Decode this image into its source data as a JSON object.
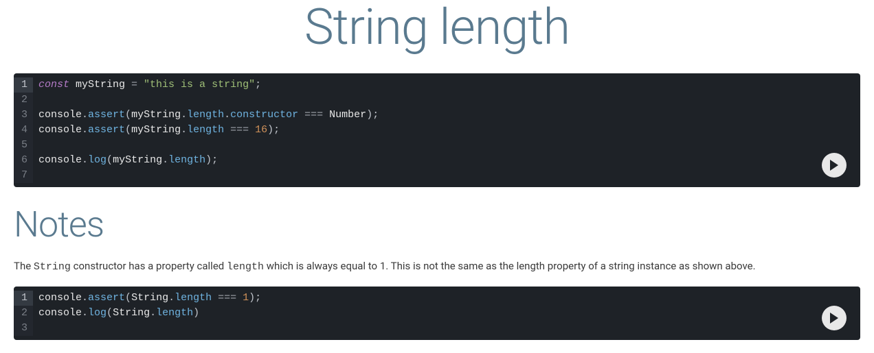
{
  "title": "String length",
  "notes_heading": "Notes",
  "note": {
    "p1": "The ",
    "code1": "String",
    "p2": " constructor has a property called ",
    "code2": "length",
    "p3": " which is always equal to 1. This is not the same as the length property of a string instance as shown above."
  },
  "code1": {
    "lines": [
      {
        "n": "1",
        "t": [
          [
            "k",
            "const"
          ],
          [
            "w",
            " myString"
          ],
          [
            "o",
            " = "
          ],
          [
            "s",
            "\"this is a string\""
          ],
          [
            "p",
            ";"
          ]
        ]
      },
      {
        "n": "2",
        "t": []
      },
      {
        "n": "3",
        "t": [
          [
            "w",
            "console"
          ],
          [
            "p",
            "."
          ],
          [
            "m",
            "assert"
          ],
          [
            "p",
            "("
          ],
          [
            "w",
            "myString"
          ],
          [
            "p",
            "."
          ],
          [
            "prop",
            "length"
          ],
          [
            "p",
            "."
          ],
          [
            "prop",
            "constructor"
          ],
          [
            "o",
            " === "
          ],
          [
            "w",
            "Number"
          ],
          [
            "p",
            ");"
          ]
        ]
      },
      {
        "n": "4",
        "t": [
          [
            "w",
            "console"
          ],
          [
            "p",
            "."
          ],
          [
            "m",
            "assert"
          ],
          [
            "p",
            "("
          ],
          [
            "w",
            "myString"
          ],
          [
            "p",
            "."
          ],
          [
            "prop",
            "length"
          ],
          [
            "o",
            " === "
          ],
          [
            "n",
            "16"
          ],
          [
            "p",
            ");"
          ]
        ]
      },
      {
        "n": "5",
        "t": []
      },
      {
        "n": "6",
        "t": [
          [
            "w",
            "console"
          ],
          [
            "p",
            "."
          ],
          [
            "m",
            "log"
          ],
          [
            "p",
            "("
          ],
          [
            "w",
            "myString"
          ],
          [
            "p",
            "."
          ],
          [
            "prop",
            "length"
          ],
          [
            "p",
            ");"
          ]
        ]
      },
      {
        "n": "7",
        "t": []
      }
    ]
  },
  "code2": {
    "lines": [
      {
        "n": "1",
        "t": [
          [
            "w",
            "console"
          ],
          [
            "p",
            "."
          ],
          [
            "m",
            "assert"
          ],
          [
            "p",
            "("
          ],
          [
            "w",
            "String"
          ],
          [
            "p",
            "."
          ],
          [
            "prop",
            "length"
          ],
          [
            "o",
            " === "
          ],
          [
            "n",
            "1"
          ],
          [
            "p",
            ");"
          ]
        ]
      },
      {
        "n": "2",
        "t": [
          [
            "w",
            "console"
          ],
          [
            "p",
            "."
          ],
          [
            "m",
            "log"
          ],
          [
            "p",
            "("
          ],
          [
            "w",
            "String"
          ],
          [
            "p",
            "."
          ],
          [
            "prop",
            "length"
          ],
          [
            "p",
            ")"
          ]
        ]
      },
      {
        "n": "3",
        "t": []
      }
    ]
  }
}
